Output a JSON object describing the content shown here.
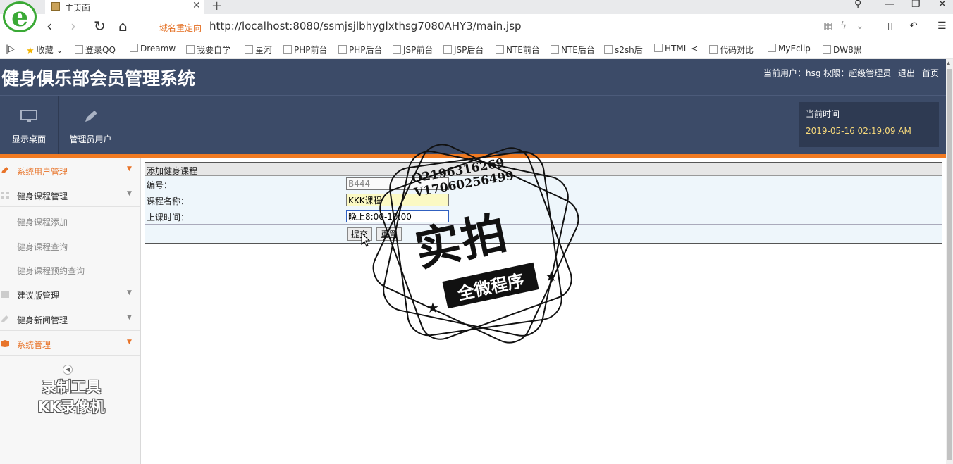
{
  "browser": {
    "tab_title": "主页面",
    "redirect_label": "域名重定向",
    "url": "http://localhost:8080/ssmjsjlbhyglxthsg7080AHY3/main.jsp",
    "bookmarks": [
      "收藏",
      "登录QQ",
      "Dreamw",
      "我要自学",
      "星河",
      "PHP前台",
      "PHP后台",
      "JSP前台",
      "JSP后台",
      "NTE前台",
      "NTE后台",
      "s2sh后",
      "HTML <",
      "代码对比",
      "MyEclip",
      "DW8黑"
    ]
  },
  "header": {
    "app_title": "健身俱乐部会员管理系统",
    "current_user_label": "当前用户：hsg",
    "permission_label": "权限：超级管理员",
    "logout": "退出",
    "home": "首页"
  },
  "toolbar": {
    "desktop": "显示桌面",
    "admin_users": "管理员用户",
    "time_label": "当前时间",
    "time_value": "2019-05-16 02:19:09 AM"
  },
  "sidebar": {
    "menus": [
      {
        "label": "系统用户管理"
      },
      {
        "label": "健身课程管理"
      },
      {
        "label": "建议版管理"
      },
      {
        "label": "健身新闻管理"
      },
      {
        "label": "系统管理"
      }
    ],
    "course_subitems": [
      "健身课程添加",
      "健身课程查询",
      "健身课程预约查询"
    ],
    "recorder_line1": "录制工具",
    "recorder_line2": "KK录像机"
  },
  "form": {
    "title": "添加健身课程",
    "fields": [
      {
        "label": "编号：",
        "value": "B444"
      },
      {
        "label": "课程名称：",
        "value": "KKK课程"
      },
      {
        "label": "上课时间：",
        "value": "晚上8:00-10:00"
      }
    ],
    "submit": "提交",
    "reset": "重置"
  },
  "watermark": {
    "contact_line1": "Q2196316269",
    "contact_line2": "V17060256499",
    "big_text": "实拍",
    "ribbon_text": "全微程序"
  },
  "colors": {
    "header_bg": "#3c4b68",
    "accent_orange": "#f07a22",
    "time_color": "#f5d77a"
  }
}
